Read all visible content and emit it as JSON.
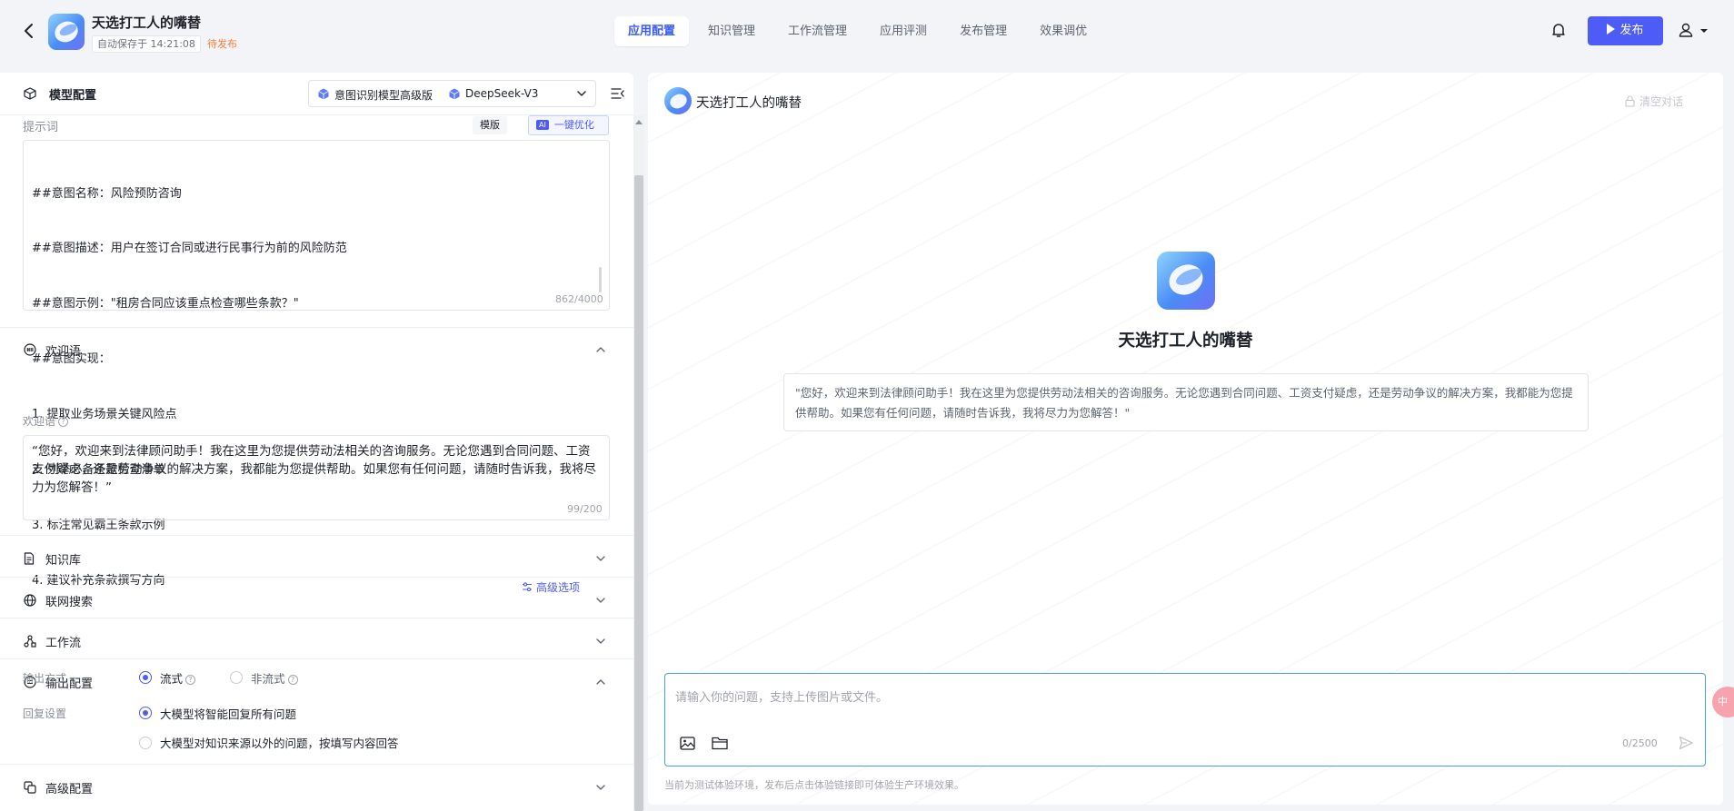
{
  "header": {
    "back_icon": "arrow-left-icon",
    "app_title": "天选打工人的嘴替",
    "save_status": "自动保存于 14:21:08",
    "publish_status": "待发布",
    "tabs": [
      {
        "label": "应用配置",
        "active": true
      },
      {
        "label": "知识管理",
        "active": false
      },
      {
        "label": "工作流管理",
        "active": false
      },
      {
        "label": "应用评测",
        "active": false
      },
      {
        "label": "发布管理",
        "active": false
      },
      {
        "label": "效果调优",
        "active": false
      }
    ],
    "bell_icon": "bell-icon",
    "publish_button": "发布",
    "user_icon": "user-icon",
    "accent_color": "#4d5cf7"
  },
  "config": {
    "model_section_label": "模型配置",
    "intent_model": "意图识别模型高级版",
    "llm_model": "DeepSeek-V3",
    "prompt": {
      "label": "提示词",
      "template_button": "模版",
      "optimize_badge": "AI",
      "optimize_button": "一键优化",
      "lines": [
        "##意图名称：风险预防咨询",
        "##意图描述：用户在签订合同或进行民事行为前的风险防范",
        "##意图示例：\"租房合同应该重点检查哪些条款？\"",
        "##意图实现：",
        "1. 提取业务场景关键风险点",
        "2. 列举必备条款检查清单",
        "3. 标注常见霸王条款示例",
        "4. 建议补充条款撰写方向"
      ],
      "counter": "862/4000"
    },
    "welcome": {
      "section_title": "欢迎语",
      "field_label": "欢迎语",
      "text": "“您好，欢迎来到法律顾问助手！我在这里为您提供劳动法相关的咨询服务。无论您遇到合同问题、工资支付疑虑，还是劳动争议的解决方案，我都能为您提供帮助。如果您有任何问题，请随时告诉我，我将尽力为您解答！”",
      "counter": "99/200"
    },
    "knowledge": {
      "title": "知识库",
      "advanced": "高级选项"
    },
    "web_search": {
      "title": "联网搜索"
    },
    "workflow": {
      "title": "工作流"
    },
    "output": {
      "title": "输出配置",
      "mode_label": "输出方式",
      "mode_options": [
        "流式",
        "非流式"
      ],
      "mode_selected": 0,
      "reply_label": "回复设置",
      "reply_options": [
        "大模型将智能回复所有问题",
        "大模型对知识来源以外的问题，按填写内容回答"
      ],
      "reply_selected": 0
    },
    "advanced": {
      "title": "高级配置"
    }
  },
  "chat": {
    "title": "天选打工人的嘴替",
    "clear_button": "清空对话",
    "center_title": "天选打工人的嘴替",
    "welcome_card": "\"您好，欢迎来到法律顾问助手！我在这里为您提供劳动法相关的咨询服务。无论您遇到合同问题、工资支付疑虑，还是劳动争议的解决方案，我都能为您提供帮助。如果您有任何问题，请随时告诉我，我将尽力为您解答！\"",
    "input_placeholder": "请输入你的问题，支持上传图片或文件。",
    "input_counter": "0/2500",
    "footnote": "当前为测试体验环境，发布后点击体验链接即可体验生产环境效果。",
    "float_button": "中"
  }
}
